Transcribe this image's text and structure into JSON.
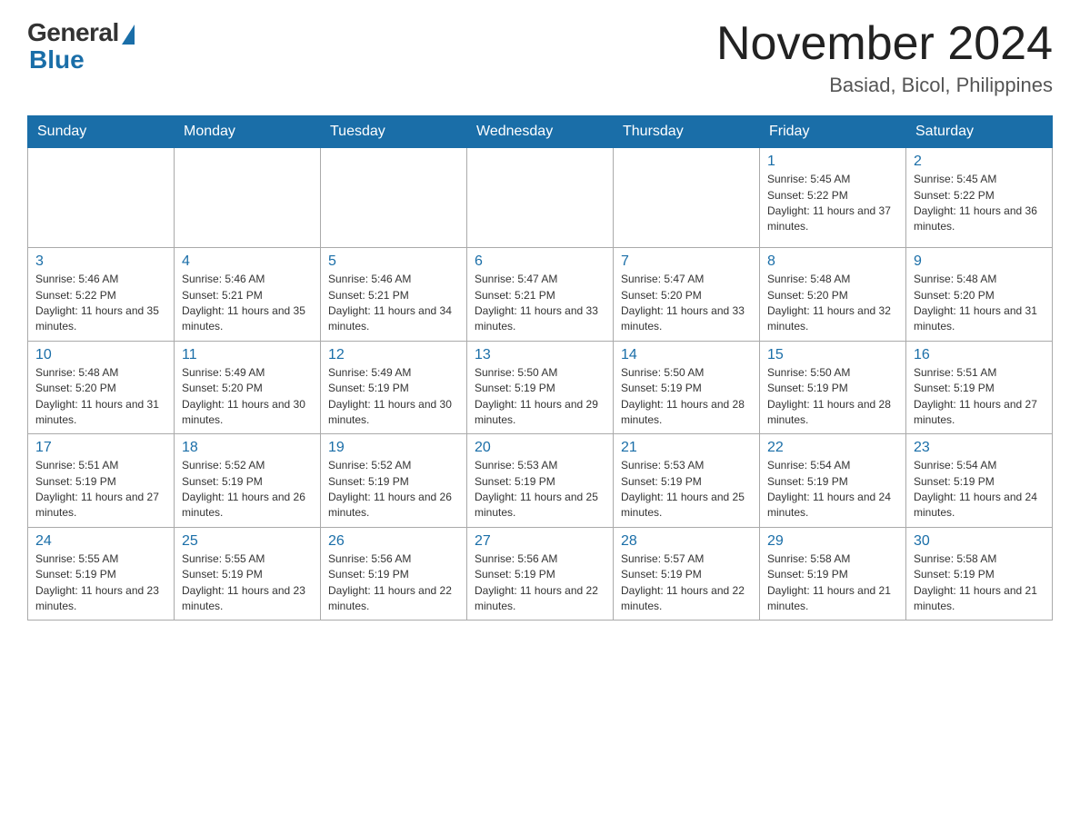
{
  "logo": {
    "general": "General",
    "blue": "Blue"
  },
  "header": {
    "month": "November 2024",
    "location": "Basiad, Bicol, Philippines"
  },
  "days_of_week": [
    "Sunday",
    "Monday",
    "Tuesday",
    "Wednesday",
    "Thursday",
    "Friday",
    "Saturday"
  ],
  "weeks": [
    [
      {
        "day": "",
        "sunrise": "",
        "sunset": "",
        "daylight": ""
      },
      {
        "day": "",
        "sunrise": "",
        "sunset": "",
        "daylight": ""
      },
      {
        "day": "",
        "sunrise": "",
        "sunset": "",
        "daylight": ""
      },
      {
        "day": "",
        "sunrise": "",
        "sunset": "",
        "daylight": ""
      },
      {
        "day": "",
        "sunrise": "",
        "sunset": "",
        "daylight": ""
      },
      {
        "day": "1",
        "sunrise": "Sunrise: 5:45 AM",
        "sunset": "Sunset: 5:22 PM",
        "daylight": "Daylight: 11 hours and 37 minutes."
      },
      {
        "day": "2",
        "sunrise": "Sunrise: 5:45 AM",
        "sunset": "Sunset: 5:22 PM",
        "daylight": "Daylight: 11 hours and 36 minutes."
      }
    ],
    [
      {
        "day": "3",
        "sunrise": "Sunrise: 5:46 AM",
        "sunset": "Sunset: 5:22 PM",
        "daylight": "Daylight: 11 hours and 35 minutes."
      },
      {
        "day": "4",
        "sunrise": "Sunrise: 5:46 AM",
        "sunset": "Sunset: 5:21 PM",
        "daylight": "Daylight: 11 hours and 35 minutes."
      },
      {
        "day": "5",
        "sunrise": "Sunrise: 5:46 AM",
        "sunset": "Sunset: 5:21 PM",
        "daylight": "Daylight: 11 hours and 34 minutes."
      },
      {
        "day": "6",
        "sunrise": "Sunrise: 5:47 AM",
        "sunset": "Sunset: 5:21 PM",
        "daylight": "Daylight: 11 hours and 33 minutes."
      },
      {
        "day": "7",
        "sunrise": "Sunrise: 5:47 AM",
        "sunset": "Sunset: 5:20 PM",
        "daylight": "Daylight: 11 hours and 33 minutes."
      },
      {
        "day": "8",
        "sunrise": "Sunrise: 5:48 AM",
        "sunset": "Sunset: 5:20 PM",
        "daylight": "Daylight: 11 hours and 32 minutes."
      },
      {
        "day": "9",
        "sunrise": "Sunrise: 5:48 AM",
        "sunset": "Sunset: 5:20 PM",
        "daylight": "Daylight: 11 hours and 31 minutes."
      }
    ],
    [
      {
        "day": "10",
        "sunrise": "Sunrise: 5:48 AM",
        "sunset": "Sunset: 5:20 PM",
        "daylight": "Daylight: 11 hours and 31 minutes."
      },
      {
        "day": "11",
        "sunrise": "Sunrise: 5:49 AM",
        "sunset": "Sunset: 5:20 PM",
        "daylight": "Daylight: 11 hours and 30 minutes."
      },
      {
        "day": "12",
        "sunrise": "Sunrise: 5:49 AM",
        "sunset": "Sunset: 5:19 PM",
        "daylight": "Daylight: 11 hours and 30 minutes."
      },
      {
        "day": "13",
        "sunrise": "Sunrise: 5:50 AM",
        "sunset": "Sunset: 5:19 PM",
        "daylight": "Daylight: 11 hours and 29 minutes."
      },
      {
        "day": "14",
        "sunrise": "Sunrise: 5:50 AM",
        "sunset": "Sunset: 5:19 PM",
        "daylight": "Daylight: 11 hours and 28 minutes."
      },
      {
        "day": "15",
        "sunrise": "Sunrise: 5:50 AM",
        "sunset": "Sunset: 5:19 PM",
        "daylight": "Daylight: 11 hours and 28 minutes."
      },
      {
        "day": "16",
        "sunrise": "Sunrise: 5:51 AM",
        "sunset": "Sunset: 5:19 PM",
        "daylight": "Daylight: 11 hours and 27 minutes."
      }
    ],
    [
      {
        "day": "17",
        "sunrise": "Sunrise: 5:51 AM",
        "sunset": "Sunset: 5:19 PM",
        "daylight": "Daylight: 11 hours and 27 minutes."
      },
      {
        "day": "18",
        "sunrise": "Sunrise: 5:52 AM",
        "sunset": "Sunset: 5:19 PM",
        "daylight": "Daylight: 11 hours and 26 minutes."
      },
      {
        "day": "19",
        "sunrise": "Sunrise: 5:52 AM",
        "sunset": "Sunset: 5:19 PM",
        "daylight": "Daylight: 11 hours and 26 minutes."
      },
      {
        "day": "20",
        "sunrise": "Sunrise: 5:53 AM",
        "sunset": "Sunset: 5:19 PM",
        "daylight": "Daylight: 11 hours and 25 minutes."
      },
      {
        "day": "21",
        "sunrise": "Sunrise: 5:53 AM",
        "sunset": "Sunset: 5:19 PM",
        "daylight": "Daylight: 11 hours and 25 minutes."
      },
      {
        "day": "22",
        "sunrise": "Sunrise: 5:54 AM",
        "sunset": "Sunset: 5:19 PM",
        "daylight": "Daylight: 11 hours and 24 minutes."
      },
      {
        "day": "23",
        "sunrise": "Sunrise: 5:54 AM",
        "sunset": "Sunset: 5:19 PM",
        "daylight": "Daylight: 11 hours and 24 minutes."
      }
    ],
    [
      {
        "day": "24",
        "sunrise": "Sunrise: 5:55 AM",
        "sunset": "Sunset: 5:19 PM",
        "daylight": "Daylight: 11 hours and 23 minutes."
      },
      {
        "day": "25",
        "sunrise": "Sunrise: 5:55 AM",
        "sunset": "Sunset: 5:19 PM",
        "daylight": "Daylight: 11 hours and 23 minutes."
      },
      {
        "day": "26",
        "sunrise": "Sunrise: 5:56 AM",
        "sunset": "Sunset: 5:19 PM",
        "daylight": "Daylight: 11 hours and 22 minutes."
      },
      {
        "day": "27",
        "sunrise": "Sunrise: 5:56 AM",
        "sunset": "Sunset: 5:19 PM",
        "daylight": "Daylight: 11 hours and 22 minutes."
      },
      {
        "day": "28",
        "sunrise": "Sunrise: 5:57 AM",
        "sunset": "Sunset: 5:19 PM",
        "daylight": "Daylight: 11 hours and 22 minutes."
      },
      {
        "day": "29",
        "sunrise": "Sunrise: 5:58 AM",
        "sunset": "Sunset: 5:19 PM",
        "daylight": "Daylight: 11 hours and 21 minutes."
      },
      {
        "day": "30",
        "sunrise": "Sunrise: 5:58 AM",
        "sunset": "Sunset: 5:19 PM",
        "daylight": "Daylight: 11 hours and 21 minutes."
      }
    ]
  ]
}
